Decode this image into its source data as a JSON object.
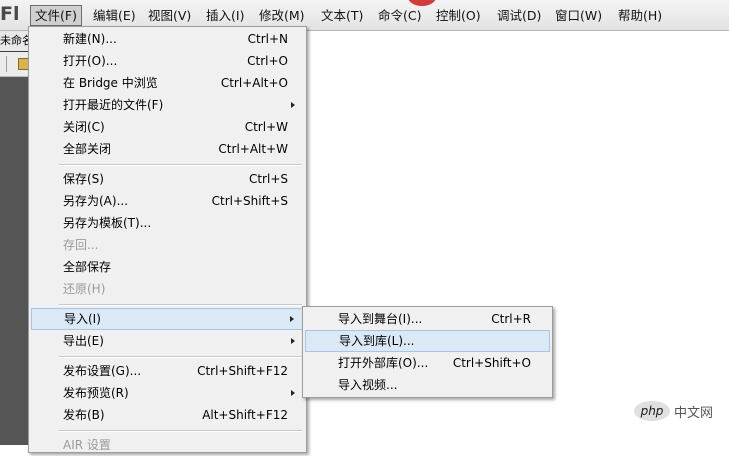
{
  "app": {
    "logo": "Fl"
  },
  "menubar": {
    "items": [
      {
        "label": "文件(F)",
        "active": true
      },
      {
        "label": "编辑(E)"
      },
      {
        "label": "视图(V)"
      },
      {
        "label": "插入(I)"
      },
      {
        "label": "修改(M)"
      },
      {
        "label": "文本(T)"
      },
      {
        "label": "命令(C)"
      },
      {
        "label": "控制(O)"
      },
      {
        "label": "调试(D)"
      },
      {
        "label": "窗口(W)"
      },
      {
        "label": "帮助(H)"
      }
    ]
  },
  "document_tab": {
    "label": "未命名"
  },
  "file_menu": {
    "items": [
      {
        "label": "新建(N)...",
        "shortcut": "Ctrl+N"
      },
      {
        "label": "打开(O)...",
        "shortcut": "Ctrl+O"
      },
      {
        "label": "在 Bridge 中浏览",
        "shortcut": "Ctrl+Alt+O"
      },
      {
        "label": "打开最近的文件(F)",
        "shortcut": ""
      },
      {
        "label": "关闭(C)",
        "shortcut": "Ctrl+W"
      },
      {
        "label": "全部关闭",
        "shortcut": "Ctrl+Alt+W"
      },
      {
        "label": "保存(S)",
        "shortcut": "Ctrl+S"
      },
      {
        "label": "另存为(A)...",
        "shortcut": "Ctrl+Shift+S"
      },
      {
        "label": "另存为模板(T)...",
        "shortcut": ""
      },
      {
        "label": "存回...",
        "shortcut": ""
      },
      {
        "label": "全部保存",
        "shortcut": ""
      },
      {
        "label": "还原(H)",
        "shortcut": ""
      },
      {
        "label": "导入(I)",
        "shortcut": ""
      },
      {
        "label": "导出(E)",
        "shortcut": ""
      },
      {
        "label": "发布设置(G)...",
        "shortcut": "Ctrl+Shift+F12"
      },
      {
        "label": "发布预览(R)",
        "shortcut": ""
      },
      {
        "label": "发布(B)",
        "shortcut": "Alt+Shift+F12"
      },
      {
        "label": "AIR 设置",
        "shortcut": ""
      }
    ]
  },
  "import_submenu": {
    "items": [
      {
        "label": "导入到舞台(I)...",
        "shortcut": "Ctrl+R"
      },
      {
        "label": "导入到库(L)...",
        "shortcut": ""
      },
      {
        "label": "打开外部库(O)...",
        "shortcut": "Ctrl+Shift+O"
      },
      {
        "label": "导入视频...",
        "shortcut": ""
      }
    ]
  },
  "watermark": {
    "logo": "php",
    "text": "中文网"
  },
  "colors": {
    "menu_highlight": "#dbe8f6",
    "disabled_text": "#9a9a9a",
    "workspace_dark": "#555555"
  }
}
